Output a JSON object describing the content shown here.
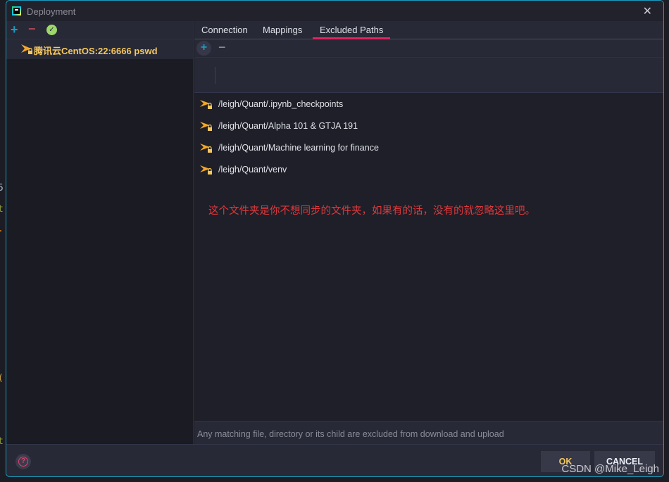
{
  "window": {
    "title": "Deployment",
    "close_icon": "close-icon"
  },
  "sidebar": {
    "toolbar": {
      "add_icon": "plus-icon",
      "remove_icon": "minus-icon",
      "default_icon": "check-circle-icon"
    },
    "servers": [
      {
        "label": "腾讯云CentOS:22:6666 pswd",
        "icon": "sftp-server-icon",
        "selected": true
      }
    ]
  },
  "tabs": [
    {
      "label": "Connection",
      "active": false
    },
    {
      "label": "Mappings",
      "active": false
    },
    {
      "label": "Excluded Paths",
      "active": true
    }
  ],
  "excluded_paths": {
    "toolbar": {
      "add_icon": "plus-icon",
      "remove_icon": "minus-icon"
    },
    "input_value": "",
    "items": [
      {
        "path": "/leigh/Quant/.ipynb_checkpoints",
        "icon": "remote-folder-lock-icon"
      },
      {
        "path": "/leigh/Quant/Alpha 101 & GTJA 191",
        "icon": "remote-folder-lock-icon"
      },
      {
        "path": "/leigh/Quant/Machine learning for finance",
        "icon": "remote-folder-lock-icon"
      },
      {
        "path": "/leigh/Quant/venv",
        "icon": "remote-folder-lock-icon"
      }
    ],
    "annotation": "这个文件夹是你不想同步的文件夹，如果有的话，没有的就忽略这里吧。",
    "hint": "Any matching file, directory or its child are excluded from download and upload"
  },
  "footer": {
    "help_icon": "help-icon",
    "ok_label": "OK",
    "cancel_label": "CANCEL"
  },
  "watermark": "CSDN @Mike_Leigh",
  "colors": {
    "accent_border": "#1a9cbf",
    "active_tab_underline": "#e1245f",
    "server_label": "#f5c85f",
    "annotation": "#e0383c"
  }
}
